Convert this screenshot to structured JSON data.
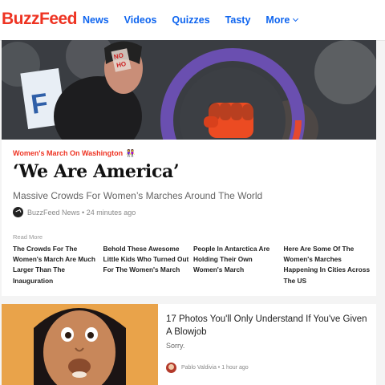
{
  "brand": {
    "logo_text": "BuzzFeed",
    "logo_color": "#ee3322",
    "link_color": "#0f65ef"
  },
  "nav": {
    "items": [
      {
        "label": "News"
      },
      {
        "label": "Videos"
      },
      {
        "label": "Quizzes"
      },
      {
        "label": "Tasty"
      },
      {
        "label": "More"
      }
    ]
  },
  "featured": {
    "image_icon": "protest-photo",
    "kicker": "Women's March On Washington",
    "kicker_icon": "women-pair-icon",
    "headline": "‘We Are America’",
    "subhead": "Massive Crowds For Women’s Marches Around The World",
    "author": "BuzzFeed News",
    "time": "24 minutes ago",
    "read_more_label": "Read More",
    "related": [
      {
        "title": "The Crowds For The Women's March Are Much Larger Than The Inauguration"
      },
      {
        "title": "Behold These Awesome Little Kids Who Turned Out For The Women's March"
      },
      {
        "title": "People In Antarctica Are Holding Their Own Women's March"
      },
      {
        "title": "Here Are Some Of The Women's Marches Happening In Cities Across The US"
      }
    ]
  },
  "story2": {
    "image_icon": "cartoon-thumbnail",
    "title": "17 Photos You'll Only Understand If You've Given A Blowjob",
    "description": "Sorry.",
    "author": "Pablo Valdivia",
    "time": "1 hour ago"
  }
}
